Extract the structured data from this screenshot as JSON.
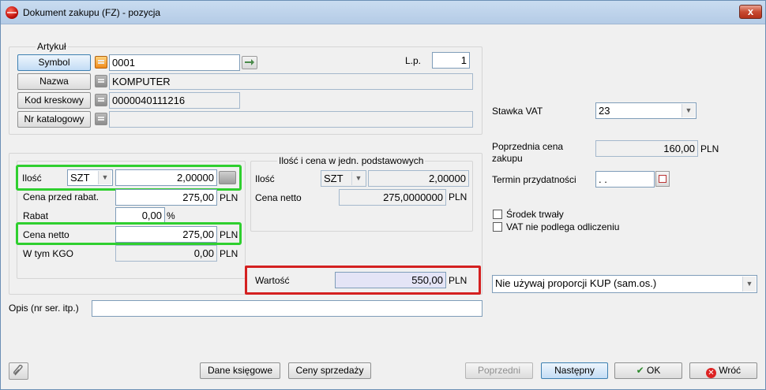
{
  "window": {
    "title": "Dokument zakupu (FZ) - pozycja",
    "close_label": "x"
  },
  "artykul": {
    "legend": "Artykuł",
    "symbol_button": "Symbol",
    "symbol_value": "0001",
    "nazwa_button": "Nazwa",
    "nazwa_value": "KOMPUTER",
    "kod_button": "Kod kreskowy",
    "kod_value": "0000040111216",
    "nrkat_button": "Nr katalogowy",
    "nrkat_value": "",
    "lp_label": "L.p.",
    "lp_value": "1"
  },
  "left": {
    "ilosc_label": "Ilość",
    "unit": "SZT",
    "ilosc_value": "2,00000",
    "cena_przed_label": "Cena przed rabat.",
    "cena_przed_value": "275,00",
    "cena_przed_currency": "PLN",
    "rabat_label": "Rabat",
    "rabat_value": "0,00",
    "rabat_unit": "%",
    "cena_netto_label": "Cena netto",
    "cena_netto_value": "275,00",
    "cena_netto_currency": "PLN",
    "kgo_label": "W tym KGO",
    "kgo_value": "0,00",
    "kgo_currency": "PLN"
  },
  "basic": {
    "legend": "Ilość i cena w jedn. podstawowych",
    "ilosc_label": "Ilość",
    "unit": "SZT",
    "ilosc_value": "2,00000",
    "cena_label": "Cena netto",
    "cena_value": "275,0000000",
    "cena_currency": "PLN"
  },
  "wartosc": {
    "label": "Wartość",
    "value": "550,00",
    "currency": "PLN"
  },
  "opis": {
    "label": "Opis (nr ser. itp.)",
    "value": ""
  },
  "right": {
    "stawka_label": "Stawka VAT",
    "stawka_value": "23",
    "poprz_label_1": "Poprzednia cena",
    "poprz_label_2": "zakupu",
    "poprz_value": "160,00",
    "poprz_currency": "PLN",
    "termin_label": "Termin przydatności",
    "termin_value": ". .",
    "srodek_label": "Środek trwały",
    "vat_label": "VAT nie podlega odliczeniu",
    "proporcja_value": "Nie używaj proporcji KUP (sam.os.)"
  },
  "buttons": {
    "dane": "Dane księgowe",
    "ceny": "Ceny sprzedaży",
    "poprzedni": "Poprzedni",
    "nastepny": "Następny",
    "ok": "OK",
    "wroc": "Wróć"
  },
  "colors": {
    "highlight_green": "#2fcf2f",
    "highlight_red": "#d42020",
    "title_bar": "#b4cbe6"
  }
}
